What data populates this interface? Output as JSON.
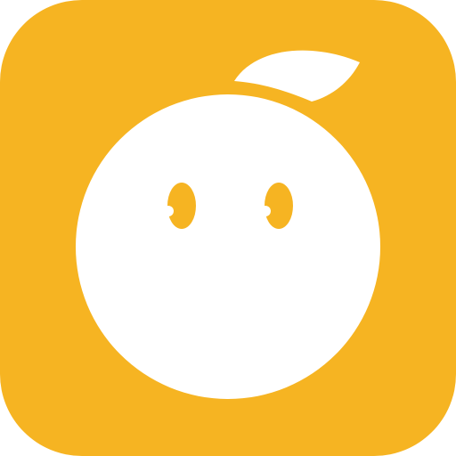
{
  "app_icon": {
    "icon_name": "orange-mascot-app-icon",
    "colors": {
      "tile": "#F6B422",
      "face": "#FFFFFF",
      "eyes": "#F6B422",
      "eye_highlight": "#FFFFFF",
      "leaf": "#FFFFFF"
    }
  }
}
